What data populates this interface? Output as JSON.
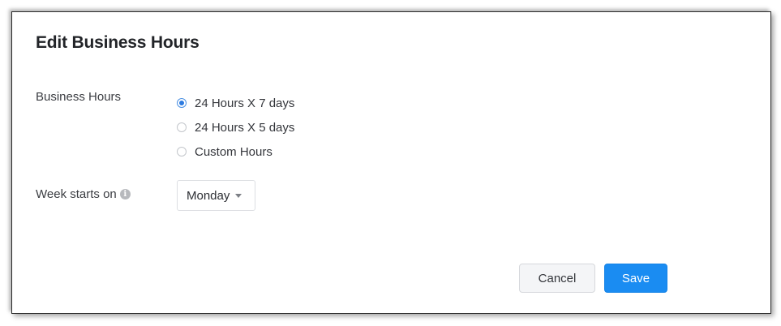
{
  "dialog": {
    "title": "Edit Business Hours"
  },
  "business_hours": {
    "label": "Business Hours",
    "options": [
      {
        "label": "24 Hours X 7 days",
        "selected": true
      },
      {
        "label": "24 Hours X 5 days",
        "selected": false
      },
      {
        "label": "Custom Hours",
        "selected": false
      }
    ]
  },
  "week_start": {
    "label": "Week starts on",
    "info_icon_glyph": "i",
    "selected_value": "Monday"
  },
  "actions": {
    "cancel_label": "Cancel",
    "save_label": "Save"
  },
  "colors": {
    "primary": "#1a8cf2",
    "radio_checked": "#2d7be0"
  }
}
